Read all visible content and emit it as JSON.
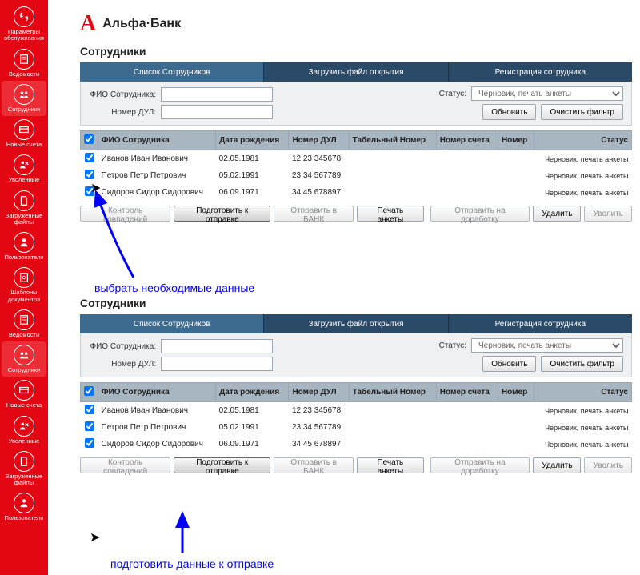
{
  "sidebar": {
    "items": [
      {
        "label": "Параметры обслуживания"
      },
      {
        "label": "Ведомости"
      },
      {
        "label": "Сотрудники",
        "active": true
      },
      {
        "label": "Новые счета"
      },
      {
        "label": "Уволенные"
      },
      {
        "label": "Загруженные файлы"
      },
      {
        "label": "Пользователи"
      },
      {
        "label": "Шаблоны документов"
      },
      {
        "label": "Ведомости"
      },
      {
        "label": "Сотрудники"
      },
      {
        "label": "Новые счета"
      },
      {
        "label": "Уволенные"
      },
      {
        "label": "Загруженные файлы"
      },
      {
        "label": "Пользователи"
      }
    ]
  },
  "brand": {
    "logo_letter": "А",
    "logo_text": "Альфа·Банк"
  },
  "section1": {
    "title": "Сотрудники",
    "tabs": [
      "Список Сотрудников",
      "Загрузить файл открытия",
      "Регистрация сотрудника"
    ],
    "filters": {
      "fio_label": "ФИО Сотрудника:",
      "dul_label": "Номер ДУЛ:",
      "status_label": "Статус:",
      "status_value": "Черновик, печать анкеты",
      "refresh": "Обновить",
      "clear": "Очистить фильтр"
    },
    "columns": [
      "",
      "ФИО Сотрудника",
      "Дата рождения",
      "Номер ДУЛ",
      "Табельный Номер",
      "Номер счета",
      "Номер",
      "Статус"
    ],
    "rows": [
      {
        "fio": "Иванов Иван Иванович",
        "dob": "02.05.1981",
        "dul": "12 23 345678",
        "status": "Черновик, печать анкеты"
      },
      {
        "fio": "Петров Петр Петрович",
        "dob": "05.02.1991",
        "dul": "23 34 567789",
        "status": "Черновик, печать анкеты"
      },
      {
        "fio": "Сидоров Сидор Сидорович",
        "dob": "06.09.1971",
        "dul": "34 45 678897",
        "status": "Черновик, печать анкеты"
      }
    ],
    "actions": {
      "control": "Контроль совпадений",
      "prepare": "Подготовить к отправке",
      "send": "Отправить в БАНК",
      "print": "Печать анкеты",
      "rework": "Отправить на доработку",
      "delete": "Удалить",
      "fire": "Уволить"
    },
    "annotation": "выбрать необходимые данные"
  },
  "section2": {
    "title": "Сотрудники",
    "tabs": [
      "Список Сотрудников",
      "Загрузить файл открытия",
      "Регистрация сотрудника"
    ],
    "filters": {
      "fio_label": "ФИО Сотрудника:",
      "dul_label": "Номер ДУЛ:",
      "status_label": "Статус:",
      "status_value": "Черновик, печать анкеты",
      "refresh": "Обновить",
      "clear": "Очистить фильтр"
    },
    "columns": [
      "",
      "ФИО Сотрудника",
      "Дата рождения",
      "Номер ДУЛ",
      "Табельный Номер",
      "Номер счета",
      "Номер",
      "Статус"
    ],
    "rows": [
      {
        "fio": "Иванов Иван Иванович",
        "dob": "02.05.1981",
        "dul": "12 23 345678",
        "status": "Черновик, печать анкеты"
      },
      {
        "fio": "Петров Петр Петрович",
        "dob": "05.02.1991",
        "dul": "23 34 567789",
        "status": "Черновик, печать анкеты"
      },
      {
        "fio": "Сидоров Сидор Сидорович",
        "dob": "06.09.1971",
        "dul": "34 45 678897",
        "status": "Черновик, печать анкеты"
      }
    ],
    "actions": {
      "control": "Контроль совпадений",
      "prepare": "Подготовить к отправке",
      "send": "Отправить в БАНК",
      "print": "Печать анкеты",
      "rework": "Отправить на доработку",
      "delete": "Удалить",
      "fire": "Уволить"
    },
    "annotation": "подготовить данные к отправке"
  }
}
